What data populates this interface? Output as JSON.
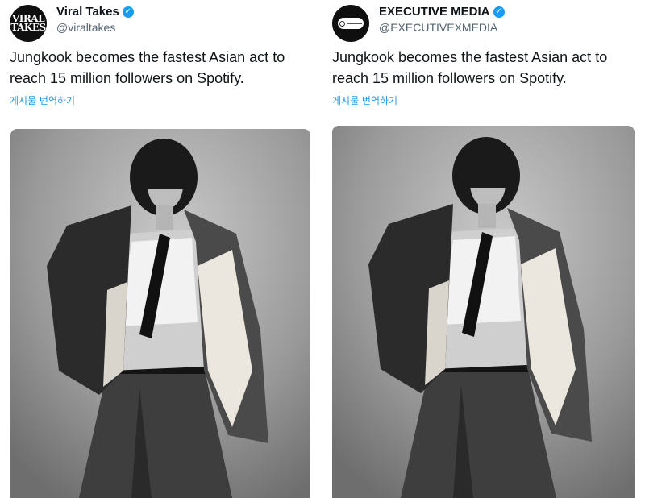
{
  "tweets": [
    {
      "display_name": "Viral Takes",
      "handle": "@viraltakes",
      "avatar_text_line1": "VIRAL",
      "avatar_text_line2": "TAKES",
      "text": "Jungkook becomes the fastest Asian act to reach 15 million followers on Spotify.",
      "translate_label": "게시물 번역하기",
      "verified_icon": "verified-badge-icon"
    },
    {
      "display_name": "EXECUTIVE MEDIA",
      "handle": "@EXECUTIVEXMEDIA",
      "text": "Jungkook becomes the fastest Asian act to reach 15 million followers on Spotify.",
      "translate_label": "게시물 번역하기",
      "verified_icon": "verified-badge-icon"
    }
  ],
  "colors": {
    "accent": "#1d9bf0",
    "text": "#0f1419",
    "secondary": "#536471"
  }
}
